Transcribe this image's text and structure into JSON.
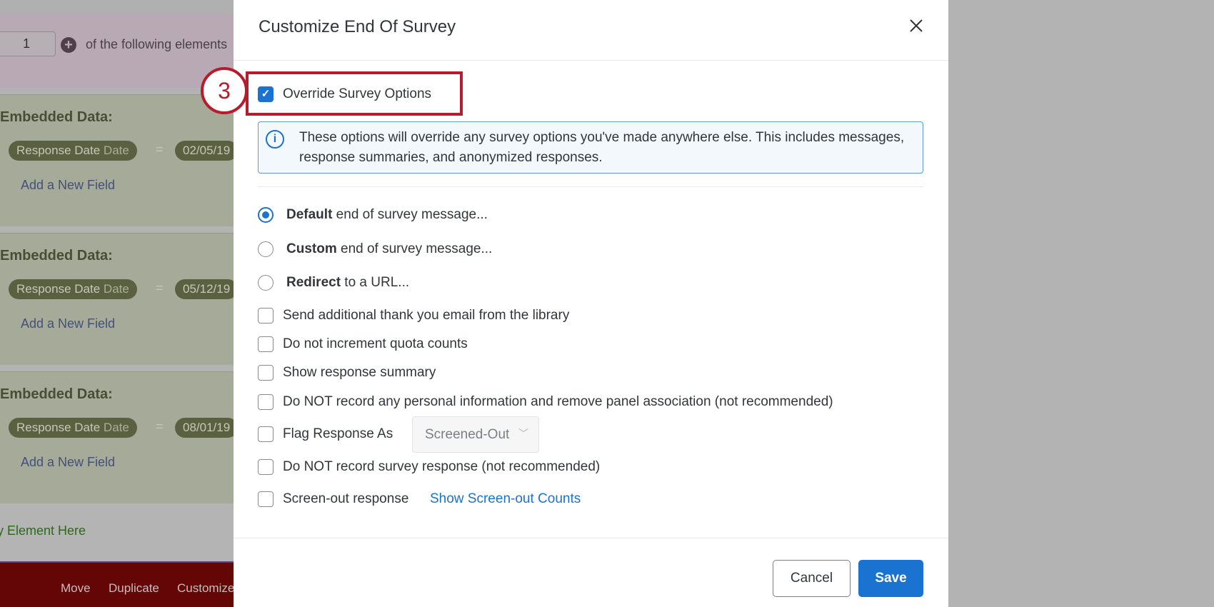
{
  "background": {
    "quantity_value": "1",
    "following_text": "of the following elements",
    "blocks": [
      {
        "label": "Embedded Data:",
        "field": "Response Date",
        "type": "Date",
        "equals": "=",
        "value": "02/05/19",
        "add_link": "Add a New Field"
      },
      {
        "label": "Embedded Data:",
        "field": "Response Date",
        "type": "Date",
        "equals": "=",
        "value": "05/12/19",
        "add_link": "Add a New Field"
      },
      {
        "label": "Embedded Data:",
        "field": "Response Date",
        "type": "Date",
        "equals": "=",
        "value": "08/01/19",
        "add_link": "Add a New Field"
      }
    ],
    "new_element": "y Element Here",
    "footer": {
      "move": "Move",
      "duplicate": "Duplicate",
      "customize": "Customize"
    }
  },
  "modal": {
    "title": "Customize End Of Survey",
    "step_badge": "3",
    "override": {
      "label": "Override Survey Options",
      "checked": true
    },
    "info": "These options will override any survey options you've made anywhere else. This includes messages, response summaries, and anonymized responses.",
    "radios": [
      {
        "bold": "Default",
        "rest": " end of survey message...",
        "selected": true
      },
      {
        "bold": "Custom",
        "rest": " end of survey message...",
        "selected": false
      },
      {
        "bold": "Redirect",
        "rest": " to a URL...",
        "selected": false
      }
    ],
    "checkboxes": [
      "Send additional thank you email from the library",
      "Do not increment quota counts",
      "Show response summary",
      "Do NOT record any personal information and remove panel association (not recommended)",
      "Flag Response As",
      "Do NOT record survey response (not recommended)",
      "Screen-out response"
    ],
    "flag_select": "Screened-Out",
    "screenout_link": "Show Screen-out Counts",
    "cancel": "Cancel",
    "save": "Save"
  },
  "colors": {
    "accent": "#1a73d0",
    "annotation": "#b61c2b"
  }
}
